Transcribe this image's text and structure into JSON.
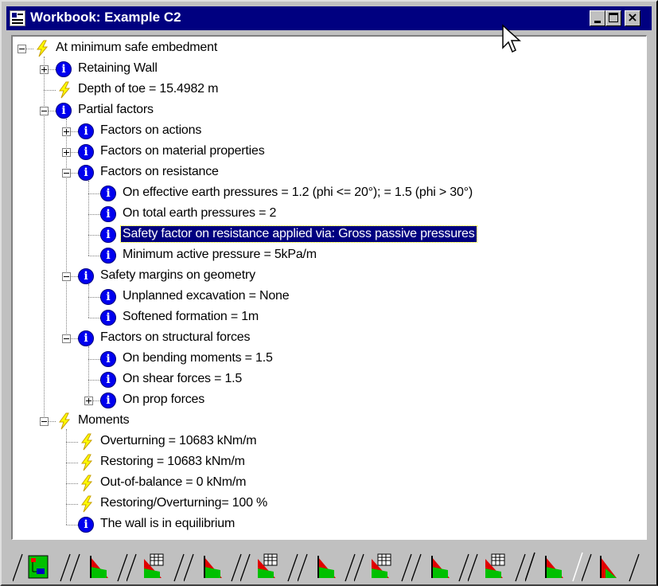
{
  "window": {
    "title": "Workbook: Example C2",
    "controls": {
      "minimize": "minimize-icon",
      "maximize": "maximize-icon",
      "close": "close-icon"
    }
  },
  "tree": {
    "items": [
      {
        "label": "At minimum safe embedment",
        "icon": "lightning-icon",
        "level": 0,
        "toggle": "collapse"
      },
      {
        "label": "Retaining Wall",
        "icon": "info-icon",
        "level": 1,
        "toggle": "expand"
      },
      {
        "label": "Depth of toe = 15.4982 m",
        "icon": "lightning-icon",
        "level": 1,
        "toggle": "none"
      },
      {
        "label": "Partial factors",
        "icon": "info-icon",
        "level": 1,
        "toggle": "collapse"
      },
      {
        "label": "Factors on actions",
        "icon": "info-icon",
        "level": 2,
        "toggle": "expand"
      },
      {
        "label": "Factors on material properties",
        "icon": "info-icon",
        "level": 2,
        "toggle": "expand"
      },
      {
        "label": "Factors on resistance",
        "icon": "info-icon",
        "level": 2,
        "toggle": "collapse"
      },
      {
        "label": "On effective earth pressures = 1.2 (phi <= 20°); = 1.5 (phi > 30°)",
        "icon": "info-icon",
        "level": 3,
        "toggle": "none"
      },
      {
        "label": "On total earth pressures = 2",
        "icon": "info-icon",
        "level": 3,
        "toggle": "none"
      },
      {
        "label": "Safety factor on resistance applied via: Gross passive pressures",
        "icon": "info-icon",
        "level": 3,
        "toggle": "none",
        "selected": true
      },
      {
        "label": "Minimum active pressure = 5kPa/m",
        "icon": "info-icon",
        "level": 3,
        "toggle": "none"
      },
      {
        "label": "Safety margins on geometry",
        "icon": "info-icon",
        "level": 2,
        "toggle": "collapse"
      },
      {
        "label": "Unplanned excavation = None",
        "icon": "info-icon",
        "level": 3,
        "toggle": "none"
      },
      {
        "label": "Softened formation = 1m",
        "icon": "info-icon",
        "level": 3,
        "toggle": "none"
      },
      {
        "label": "Factors on structural forces",
        "icon": "info-icon",
        "level": 2,
        "toggle": "collapse"
      },
      {
        "label": "On bending moments = 1.5",
        "icon": "info-icon",
        "level": 3,
        "toggle": "none"
      },
      {
        "label": "On shear forces = 1.5",
        "icon": "info-icon",
        "level": 3,
        "toggle": "none"
      },
      {
        "label": "On prop forces",
        "icon": "info-icon",
        "level": 3,
        "toggle": "expand"
      },
      {
        "label": "Moments",
        "icon": "lightning-icon",
        "level": 1,
        "toggle": "collapse"
      },
      {
        "label": "Overturning = 10683 kNm/m",
        "icon": "lightning-icon",
        "level": 2,
        "toggle": "none"
      },
      {
        "label": "Restoring = 10683 kNm/m",
        "icon": "lightning-icon",
        "level": 2,
        "toggle": "none"
      },
      {
        "label": "Out-of-balance = 0 kNm/m",
        "icon": "lightning-icon",
        "level": 2,
        "toggle": "none"
      },
      {
        "label": "Restoring/Overturning= 100 %",
        "icon": "lightning-icon",
        "level": 2,
        "toggle": "none"
      },
      {
        "label": "The wall is in equilibrium",
        "icon": "info-icon",
        "level": 2,
        "toggle": "none"
      }
    ]
  },
  "tabs": [
    {
      "icon": "workbook-tree-icon",
      "active": false
    },
    {
      "icon": "wall-diagram-icon",
      "active": false
    },
    {
      "icon": "wall-table-icon",
      "active": false
    },
    {
      "icon": "wall-diagram-icon",
      "active": false
    },
    {
      "icon": "wall-table-icon",
      "active": false
    },
    {
      "icon": "wall-diagram-icon",
      "active": false
    },
    {
      "icon": "wall-table-icon",
      "active": false
    },
    {
      "icon": "wall-diagram-icon",
      "active": false
    },
    {
      "icon": "wall-table-icon",
      "active": false
    },
    {
      "icon": "wall-diagram-icon",
      "active": true
    },
    {
      "icon": "wall-pressure-icon",
      "active": false
    }
  ],
  "colors": {
    "titlebar": "#000080",
    "selection": "#000080",
    "info": "#0000ee",
    "lightning": "#ffff00",
    "wall_green": "#00c000",
    "wall_red": "#e00000"
  }
}
